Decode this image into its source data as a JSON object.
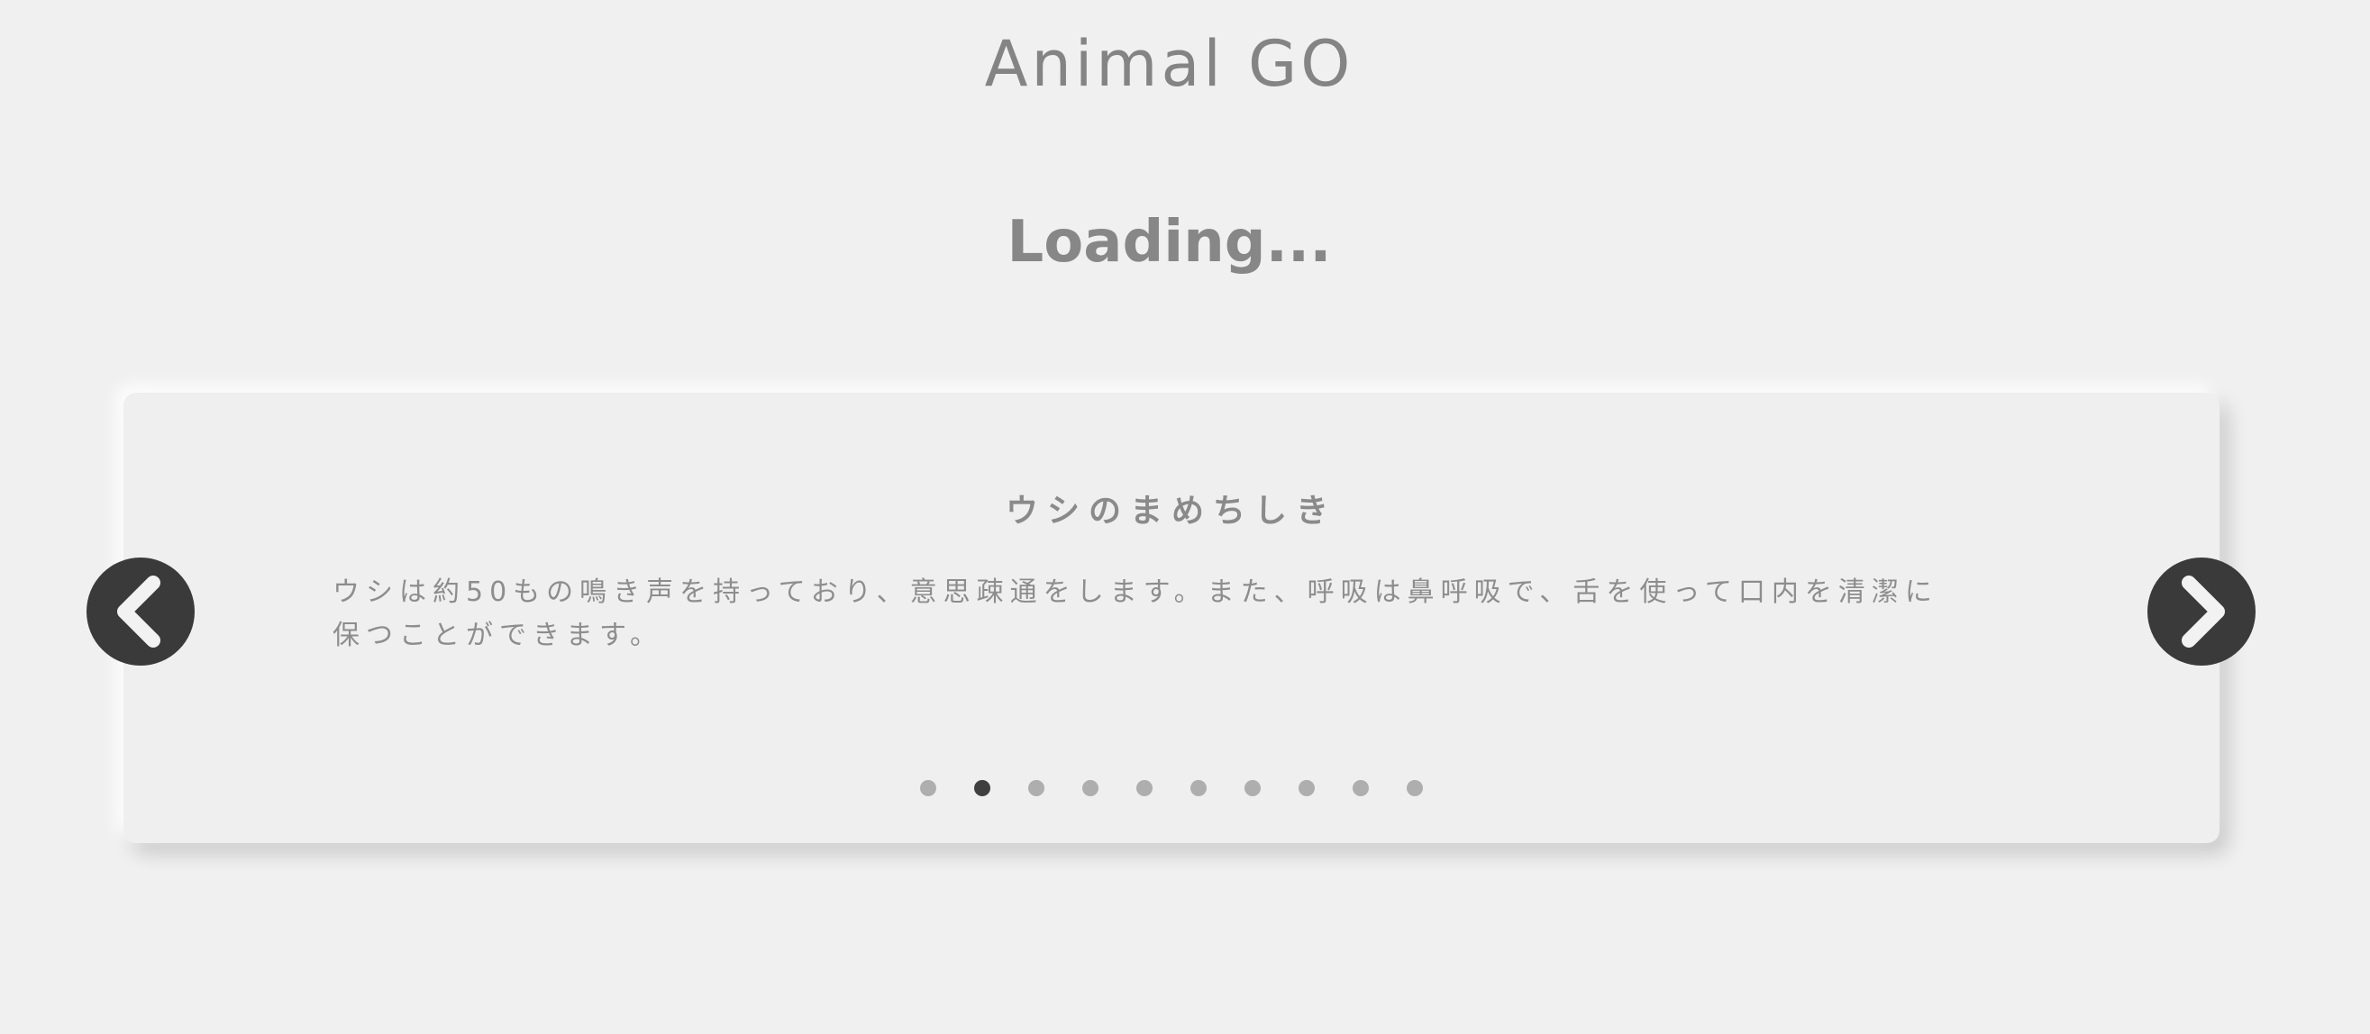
{
  "app": {
    "title": "Animal GO"
  },
  "status": {
    "loading": "Loading..."
  },
  "carousel": {
    "title": "ウシのまめちしき",
    "body_line1": "ウシは約50もの鳴き声を持っており、意思疎通をします。また、呼吸は鼻呼吸で、舌を使って口内を清潔に",
    "body_line2": "保つことができます。",
    "slide_count": 10,
    "active_index": 1,
    "prev_icon": "chevron-left-icon",
    "next_icon": "chevron-right-icon"
  },
  "colors": {
    "background": "#f0f0f0",
    "text": "#878787",
    "button": "#3a3a3a",
    "dot": "#aeaeae",
    "dot_active": "#3f3f3f"
  }
}
